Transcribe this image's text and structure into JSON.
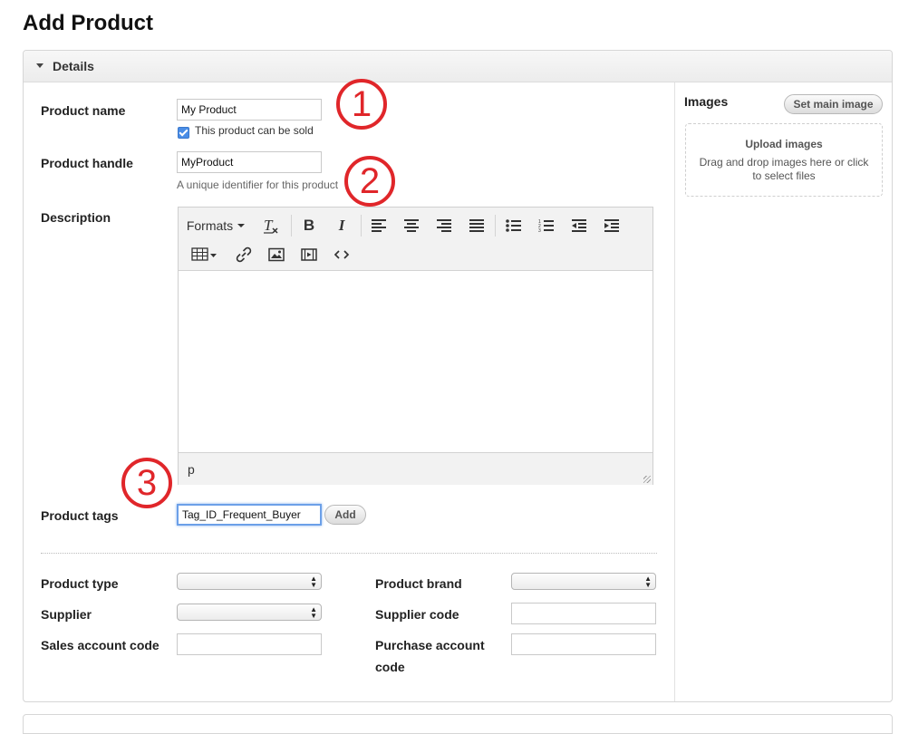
{
  "page": {
    "title": "Add Product"
  },
  "panel": {
    "title": "Details"
  },
  "fields": {
    "product_name": {
      "label": "Product name",
      "value": "My Product"
    },
    "can_be_sold": {
      "label": "This product can be sold",
      "checked": true
    },
    "product_handle": {
      "label": "Product handle",
      "value": "MyProduct",
      "hint": "A unique identifier for this product"
    },
    "description": {
      "label": "Description"
    },
    "product_tags": {
      "label": "Product tags",
      "value": "Tag_ID_Frequent_Buyer",
      "add_label": "Add"
    },
    "product_type": {
      "label": "Product type",
      "value": ""
    },
    "product_brand": {
      "label": "Product brand",
      "value": ""
    },
    "supplier": {
      "label": "Supplier",
      "value": ""
    },
    "supplier_code": {
      "label": "Supplier code",
      "value": ""
    },
    "sales_account_code": {
      "label": "Sales account code",
      "value": ""
    },
    "purchase_account_code": {
      "label_line1": "Purchase account",
      "label_line2": "code",
      "value": ""
    }
  },
  "editor": {
    "formats_label": "Formats",
    "status_path": "p",
    "toolbar_icons": [
      "clear-formatting-icon",
      "bold-icon",
      "italic-icon",
      "align-left-icon",
      "align-center-icon",
      "align-right-icon",
      "align-justify-icon",
      "bullet-list-icon",
      "numbered-list-icon",
      "outdent-icon",
      "indent-icon",
      "table-icon",
      "link-icon",
      "image-icon",
      "media-icon",
      "source-code-icon"
    ]
  },
  "images": {
    "title": "Images",
    "set_main_label": "Set main image",
    "upload_title": "Upload images",
    "upload_desc": "Drag and drop images here or click to select files"
  },
  "callouts": [
    "1",
    "2",
    "3"
  ],
  "colors": {
    "callout": "#e0262a",
    "focus": "#6ca0e8",
    "checkbox": "#4a8de6"
  }
}
